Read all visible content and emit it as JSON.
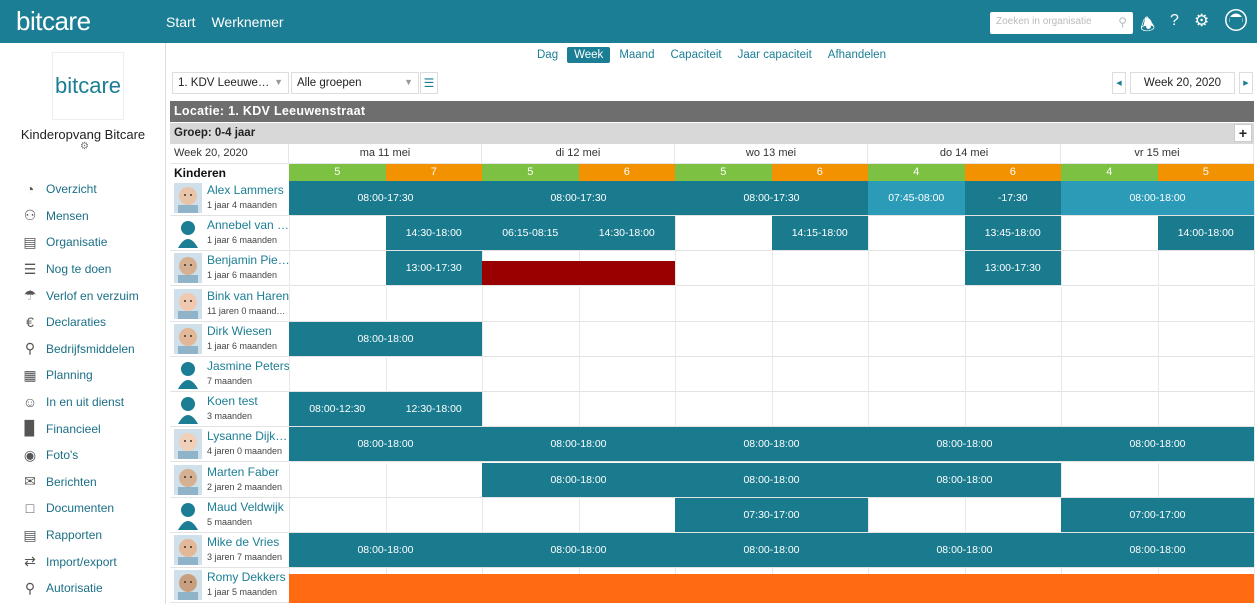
{
  "topbar": {
    "brand": "bitcare",
    "nav": [
      "Start",
      "Werknemer"
    ],
    "search_placeholder": "Zoeken in organisatie"
  },
  "sidebar": {
    "logo": "bitcare",
    "org_name": "Kinderopvang Bitcare",
    "items": [
      {
        "label": "Overzicht",
        "icon": "pie-chart-icon"
      },
      {
        "label": "Mensen",
        "icon": "people-icon"
      },
      {
        "label": "Organisatie",
        "icon": "building-icon"
      },
      {
        "label": "Nog te doen",
        "icon": "checklist-icon"
      },
      {
        "label": "Verlof en verzuim",
        "icon": "beach-umbrella-icon"
      },
      {
        "label": "Declaraties",
        "icon": "euro-icon"
      },
      {
        "label": "Bedrijfsmiddelen",
        "icon": "wrench-icon"
      },
      {
        "label": "Planning",
        "icon": "calendar-icon"
      },
      {
        "label": "In en uit dienst",
        "icon": "person-check-icon"
      },
      {
        "label": "Financieel",
        "icon": "bar-chart-icon"
      },
      {
        "label": "Foto's",
        "icon": "camera-icon"
      },
      {
        "label": "Berichten",
        "icon": "message-icon"
      },
      {
        "label": "Documenten",
        "icon": "folder-icon"
      },
      {
        "label": "Rapporten",
        "icon": "report-icon"
      },
      {
        "label": "Import/export",
        "icon": "import-export-icon"
      },
      {
        "label": "Autorisatie",
        "icon": "lock-icon"
      }
    ]
  },
  "tabs": [
    {
      "label": "Dag",
      "active": false
    },
    {
      "label": "Week",
      "active": true
    },
    {
      "label": "Maand",
      "active": false
    },
    {
      "label": "Capaciteit",
      "active": false
    },
    {
      "label": "Jaar capaciteit",
      "active": false
    },
    {
      "label": "Afhandelen",
      "active": false
    }
  ],
  "filters": {
    "location": "1. KDV Leeuwe…",
    "group": "Alle groepen"
  },
  "week_label": "Week 20, 2020",
  "location_title": "Locatie: 1. KDV Leeuwenstraat",
  "group_title": "Groep: 0-4 jaar",
  "header": {
    "week": "Week 20, 2020",
    "kinderen": "Kinderen",
    "days": [
      "ma 11 mei",
      "di 12 mei",
      "wo 13 mei",
      "do 14 mei",
      "vr 15 mei"
    ],
    "counts": [
      [
        "5",
        "7"
      ],
      [
        "5",
        "6"
      ],
      [
        "5",
        "6"
      ],
      [
        "4",
        "6"
      ],
      [
        "4",
        "5"
      ]
    ],
    "count_colors": {
      "am": "#7cc142",
      "pm": "#f39200"
    }
  },
  "colors": {
    "teal": "#1a7b8f",
    "light_teal": "#2b9bb8",
    "dark_red": "#990000",
    "orange": "#ff6a13"
  },
  "children": [
    {
      "name": "Alex Lammers",
      "age": "1 jaar 4 maanden",
      "avatar": "photo",
      "blocks": [
        {
          "s": 0,
          "e": 2,
          "t": "08:00-17:30"
        },
        {
          "s": 2,
          "e": 4,
          "t": "08:00-17:30"
        },
        {
          "s": 4,
          "e": 6,
          "t": "08:00-17:30"
        },
        {
          "s": 6,
          "e": 7,
          "t": "07:45-08:00",
          "c": "light"
        },
        {
          "s": 7,
          "e": 8,
          "t": "-17:30"
        },
        {
          "s": 8,
          "e": 10,
          "t": "08:00-18:00",
          "c": "light"
        }
      ]
    },
    {
      "name": "Annebel van …",
      "age": "1 jaar 6 maanden",
      "avatar": "silhouette",
      "blocks": [
        {
          "s": 1,
          "e": 2,
          "t": "14:30-18:00"
        },
        {
          "s": 2,
          "e": 3,
          "t": "06:15-08:15"
        },
        {
          "s": 3,
          "e": 4,
          "t": "14:30-18:00"
        },
        {
          "s": 5,
          "e": 6,
          "t": "14:15-18:00"
        },
        {
          "s": 7,
          "e": 8,
          "t": "13:45-18:00"
        },
        {
          "s": 9,
          "e": 10,
          "t": "14:00-18:00"
        }
      ]
    },
    {
      "name": "Benjamin Pie…",
      "age": "1 jaar 6 maanden",
      "avatar": "photo",
      "blocks": [
        {
          "s": 1,
          "e": 2,
          "t": "13:00-17:30"
        },
        {
          "s": 2,
          "e": 4,
          "t": "",
          "c": "red"
        },
        {
          "s": 7,
          "e": 8,
          "t": "13:00-17:30"
        }
      ]
    },
    {
      "name": "Bink van Haren",
      "age": "11 jaren 0 maand…",
      "avatar": "photo",
      "blocks": []
    },
    {
      "name": "Dirk Wiesen",
      "age": "1 jaar 6 maanden",
      "avatar": "photo",
      "blocks": [
        {
          "s": 0,
          "e": 2,
          "t": "08:00-18:00"
        }
      ]
    },
    {
      "name": "Jasmine Peters",
      "age": "7 maanden",
      "avatar": "silhouette",
      "blocks": []
    },
    {
      "name": "Koen test",
      "age": "3 maanden",
      "avatar": "silhouette",
      "blocks": [
        {
          "s": 0,
          "e": 1,
          "t": "08:00-12:30"
        },
        {
          "s": 1,
          "e": 2,
          "t": "12:30-18:00"
        }
      ]
    },
    {
      "name": "Lysanne Dijk…",
      "age": "4 jaren 0 maanden",
      "avatar": "photo",
      "blocks": [
        {
          "s": 0,
          "e": 2,
          "t": "08:00-18:00"
        },
        {
          "s": 2,
          "e": 4,
          "t": "08:00-18:00"
        },
        {
          "s": 4,
          "e": 6,
          "t": "08:00-18:00"
        },
        {
          "s": 6,
          "e": 8,
          "t": "08:00-18:00"
        },
        {
          "s": 8,
          "e": 10,
          "t": "08:00-18:00"
        }
      ]
    },
    {
      "name": "Marten Faber",
      "age": "2 jaren 2 maanden",
      "avatar": "photo",
      "blocks": [
        {
          "s": 2,
          "e": 4,
          "t": "08:00-18:00"
        },
        {
          "s": 4,
          "e": 6,
          "t": "08:00-18:00"
        },
        {
          "s": 6,
          "e": 8,
          "t": "08:00-18:00"
        }
      ]
    },
    {
      "name": "Maud Veldwijk",
      "age": "5 maanden",
      "avatar": "silhouette",
      "blocks": [
        {
          "s": 4,
          "e": 6,
          "t": "07:30-17:00"
        },
        {
          "s": 8,
          "e": 10,
          "t": "07:00-17:00"
        }
      ]
    },
    {
      "name": "Mike de Vries",
      "age": "3 jaren 7 maanden",
      "avatar": "photo",
      "blocks": [
        {
          "s": 0,
          "e": 2,
          "t": "08:00-18:00"
        },
        {
          "s": 2,
          "e": 4,
          "t": "08:00-18:00"
        },
        {
          "s": 4,
          "e": 6,
          "t": "08:00-18:00"
        },
        {
          "s": 6,
          "e": 8,
          "t": "08:00-18:00"
        },
        {
          "s": 8,
          "e": 10,
          "t": "08:00-18:00"
        }
      ]
    },
    {
      "name": "Romy Dekkers",
      "age": "1 jaar 5 maanden",
      "avatar": "photo",
      "blocks": [
        {
          "s": 0,
          "e": 10,
          "t": "",
          "c": "orange"
        }
      ]
    }
  ]
}
